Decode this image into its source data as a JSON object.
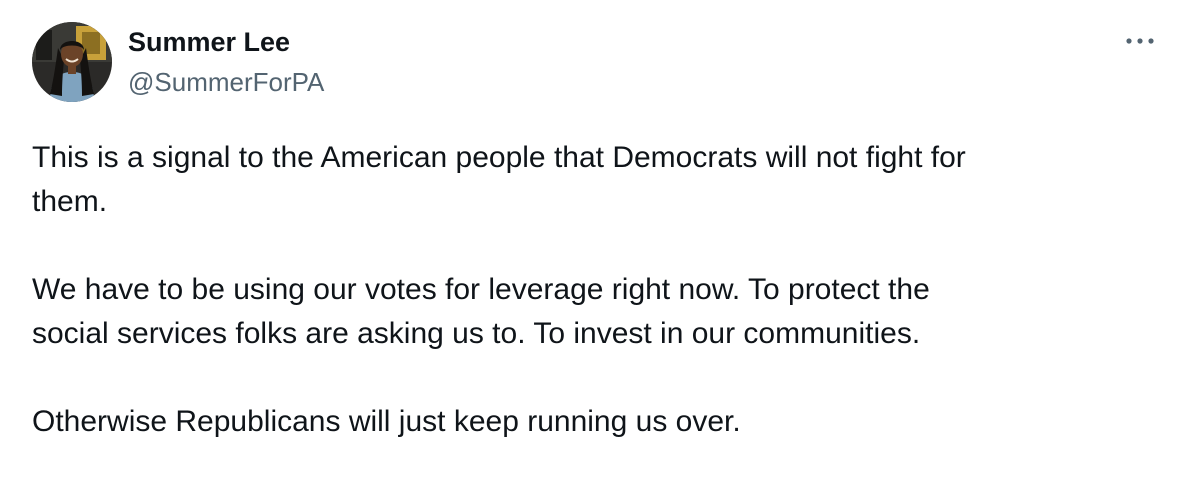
{
  "author": {
    "name": "Summer Lee",
    "handle": "@SummerForPA"
  },
  "more_icon": "more-horizontal-icon",
  "tweet": {
    "paragraphs": [
      "This is a signal to the American people that Democrats will not fight for\nthem.",
      "We have to be using our votes for leverage right now. To protect the\nsocial services folks are asking us to. To invest in our communities.",
      "Otherwise Republicans will just keep running us over."
    ]
  },
  "colors": {
    "text": "#0f1419",
    "secondary": "#536471"
  }
}
